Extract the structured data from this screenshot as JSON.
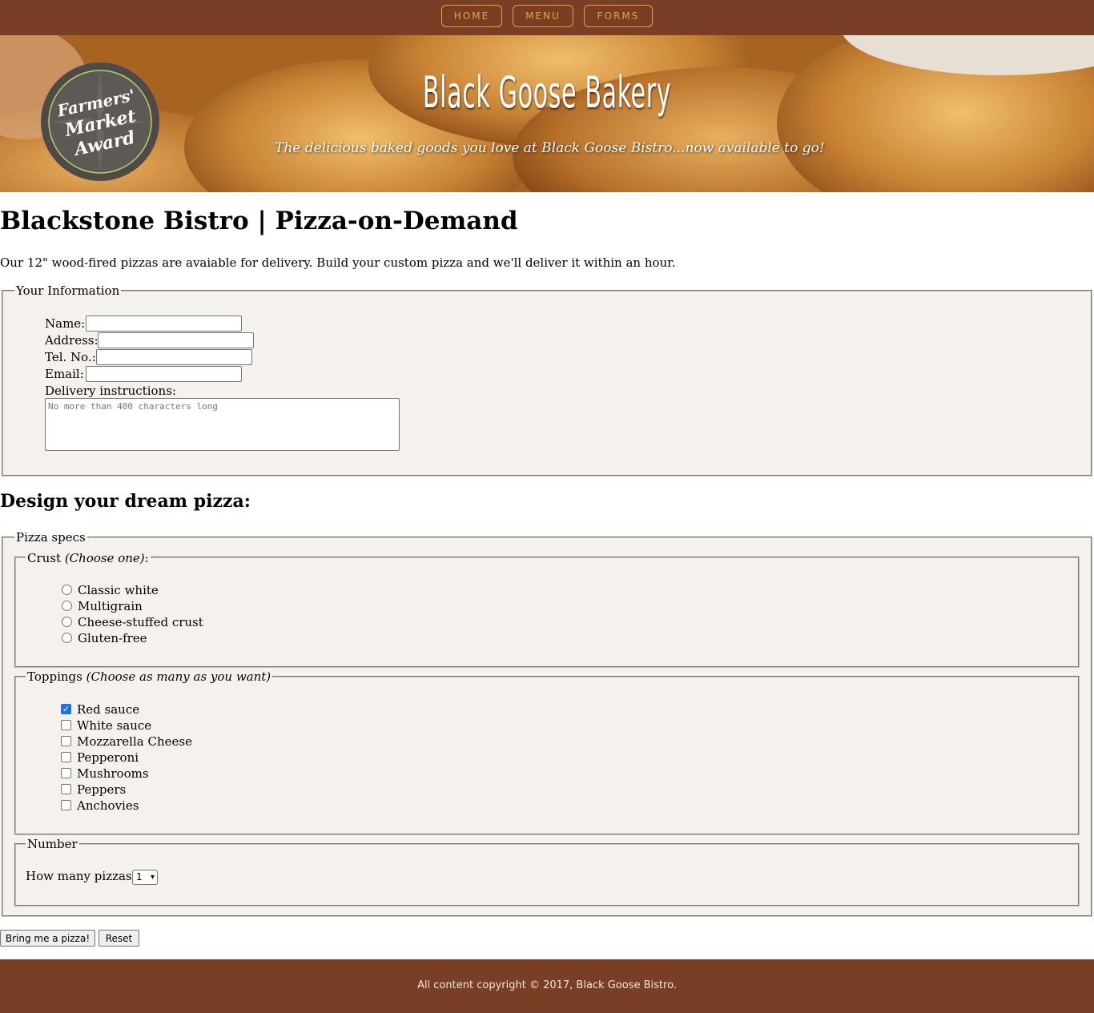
{
  "nav": {
    "items": [
      {
        "label": "HOME"
      },
      {
        "label": "MENU"
      },
      {
        "label": "FORMS"
      }
    ],
    "accent_color": "#f0a030",
    "background_color": "#783e26"
  },
  "hero": {
    "badge_lines": [
      "Farmers'",
      "Market",
      "Award"
    ],
    "title": "Black Goose Bakery",
    "tagline": "The delicious baked goods you love at Black Goose Bistro...now available to go!"
  },
  "main": {
    "title": "Blackstone Bistro | Pizza-on-Demand",
    "intro": "Our 12\" wood-fired pizzas are avaiable for delivery. Build your custom pizza and we'll deliver it within an hour."
  },
  "info_form": {
    "legend": "Your Information",
    "fields": {
      "name": {
        "label": "Name:",
        "value": ""
      },
      "address": {
        "label": "Address:",
        "value": ""
      },
      "tel": {
        "label": "Tel. No.:",
        "value": ""
      },
      "email": {
        "label": "Email:",
        "value": ""
      }
    },
    "delivery": {
      "label": "Delivery instructions:",
      "placeholder": "No more than 400 characters long"
    }
  },
  "pizza_form": {
    "section_title": "Design your dream pizza:",
    "legend": "Pizza specs",
    "crust": {
      "legend_main": "Crust",
      "legend_note": "(Choose one)",
      "legend_suffix": ":",
      "options": [
        {
          "label": "Classic white",
          "selected": false
        },
        {
          "label": "Multigrain",
          "selected": false
        },
        {
          "label": "Cheese-stuffed crust",
          "selected": false
        },
        {
          "label": "Gluten-free",
          "selected": false
        }
      ]
    },
    "toppings": {
      "legend_main": "Toppings",
      "legend_note": "(Choose as many as you want)",
      "options": [
        {
          "label": "Red sauce",
          "checked": true
        },
        {
          "label": "White sauce",
          "checked": false
        },
        {
          "label": "Mozzarella Cheese",
          "checked": false
        },
        {
          "label": "Pepperoni",
          "checked": false
        },
        {
          "label": "Mushrooms",
          "checked": false
        },
        {
          "label": "Peppers",
          "checked": false
        },
        {
          "label": "Anchovies",
          "checked": false
        }
      ]
    },
    "number": {
      "legend": "Number",
      "label": "How many pizzas:",
      "selected": "1"
    }
  },
  "buttons": {
    "submit": "Bring me a pizza!",
    "reset": "Reset"
  },
  "footer": {
    "text": "All content copyright © 2017, Black Goose Bistro."
  }
}
